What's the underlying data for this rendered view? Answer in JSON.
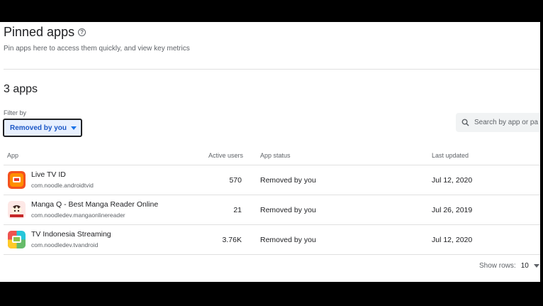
{
  "header": {
    "title": "Pinned apps",
    "help_icon": "help-circle-icon",
    "subtitle": "Pin apps here to access them quickly, and view key metrics"
  },
  "summary": {
    "count_label": "3 apps"
  },
  "filter": {
    "label": "Filter by",
    "selected": "Removed by you"
  },
  "search": {
    "placeholder": "Search by app or pa"
  },
  "table": {
    "columns": [
      "App",
      "Active users",
      "App status",
      "Last updated"
    ],
    "rows": [
      {
        "name": "Live TV ID",
        "package": "com.noodle.androidtvid",
        "active_users": "570",
        "status": "Removed by you",
        "last_updated": "Jul 12, 2020",
        "icon": "live-tv-app-icon"
      },
      {
        "name": "Manga Q - Best Manga Reader Online",
        "package": "com.noodledev.mangaonlinereader",
        "active_users": "21",
        "status": "Removed by you",
        "last_updated": "Jul 26, 2019",
        "icon": "manga-app-icon"
      },
      {
        "name": "TV Indonesia Streaming",
        "package": "com.noodledev.tvandroid",
        "active_users": "3.76K",
        "status": "Removed by you",
        "last_updated": "Jul 12, 2020",
        "icon": "tv-indonesia-app-icon"
      }
    ]
  },
  "pagination": {
    "show_rows_label": "Show rows:",
    "rows_value": "10"
  },
  "colors": {
    "accent": "#1a73e8",
    "filter_bg": "#e8f0fe",
    "text": "#202124",
    "muted": "#5f6368"
  }
}
